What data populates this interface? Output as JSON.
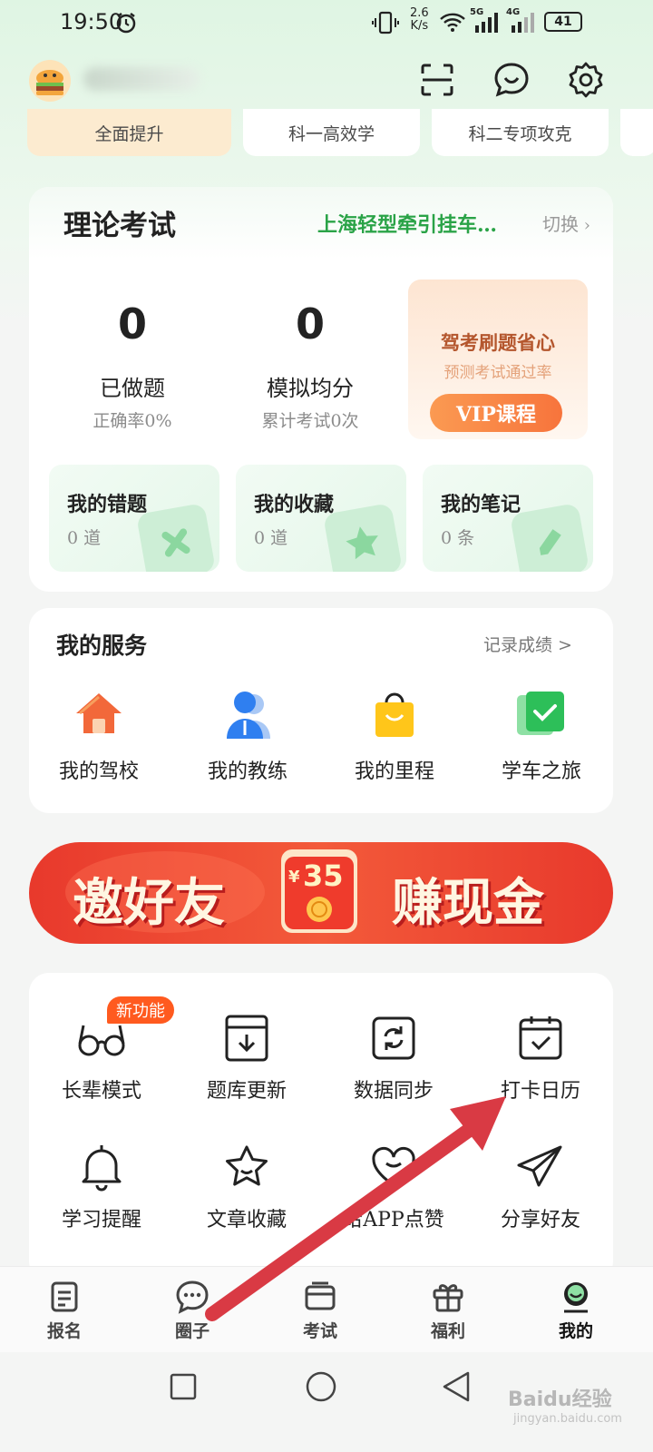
{
  "status_bar": {
    "time": "19:50",
    "speed": "2.6",
    "speed_unit": "K/s",
    "net1": "5G",
    "net2": "4G",
    "battery": "41"
  },
  "header": {
    "avatar_icon": "burger-avatar-icon",
    "actions": [
      "scan-icon",
      "message-icon",
      "gear-icon"
    ]
  },
  "subject_tabs": [
    "全面提升",
    "科一高效学",
    "科二专项攻克"
  ],
  "theory": {
    "title": "理论考试",
    "car_type": "上海轻型牵引挂车…",
    "switch_label": "切换",
    "done_count": "0",
    "done_label": "已做题",
    "accuracy": "正确率0%",
    "avg_score": "0",
    "avg_label": "模拟均分",
    "exam_count": "累计考试0次",
    "vip": {
      "title": "驾考刷题省心",
      "subtitle": "预测考试通过率",
      "button": "VIP课程"
    },
    "shortcuts": [
      {
        "title": "我的错题",
        "count": "0 道"
      },
      {
        "title": "我的收藏",
        "count": "0 道"
      },
      {
        "title": "我的笔记",
        "count": "0 条"
      }
    ]
  },
  "services": {
    "title": "我的服务",
    "link": "记录成绩 >",
    "items": [
      {
        "label": "我的驾校",
        "icon": "school-house-icon"
      },
      {
        "label": "我的教练",
        "icon": "coach-person-icon"
      },
      {
        "label": "我的里程",
        "icon": "shopping-bag-icon"
      },
      {
        "label": "学车之旅",
        "icon": "check-square-icon"
      }
    ]
  },
  "banner": {
    "left": "邀好友",
    "amount": "35",
    "currency": "¥",
    "right": "赚现金"
  },
  "tools": {
    "badge": "新功能",
    "items": [
      {
        "label": "长辈模式",
        "icon": "glasses-icon"
      },
      {
        "label": "题库更新",
        "icon": "download-box-icon"
      },
      {
        "label": "数据同步",
        "icon": "sync-icon"
      },
      {
        "label": "打卡日历",
        "icon": "calendar-check-icon"
      },
      {
        "label": "学习提醒",
        "icon": "bell-icon"
      },
      {
        "label": "文章收藏",
        "icon": "star-icon"
      },
      {
        "label": "给APP点赞",
        "icon": "heart-icon"
      },
      {
        "label": "分享好友",
        "icon": "paper-plane-icon"
      }
    ]
  },
  "bottom_nav": [
    {
      "label": "报名",
      "icon": "signup-doc-icon"
    },
    {
      "label": "圈子",
      "icon": "chat-bubble-icon"
    },
    {
      "label": "考试",
      "icon": "exam-card-icon"
    },
    {
      "label": "福利",
      "icon": "gift-icon"
    },
    {
      "label": "我的",
      "icon": "profile-face-icon"
    }
  ],
  "watermark": {
    "text": "Baidu经验",
    "sub": "jingyan.baidu.com"
  },
  "colors": {
    "accent_green": "#2aa347",
    "orange": "#f7743c",
    "banner_red": "#e8392c",
    "arrow_red": "#d93a44"
  }
}
